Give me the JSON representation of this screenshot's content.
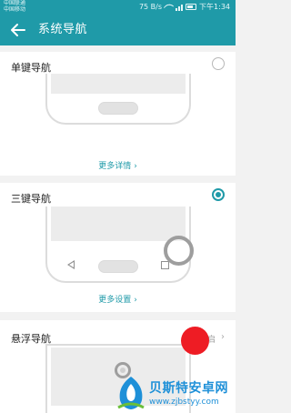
{
  "statusbar": {
    "carrier_line1": "中国联通",
    "carrier_line2": "中国移动",
    "speed": "75 B/s",
    "time": "下午1:34"
  },
  "header": {
    "title": "系统导航",
    "back_icon": "arrow-left-icon",
    "background_color": "#1f9aa8"
  },
  "options": [
    {
      "label": "单键导航",
      "selected": false,
      "link_label": "更多详情",
      "link_icon": "chevron-right-icon"
    },
    {
      "label": "三键导航",
      "selected": true,
      "link_label": "更多设置",
      "link_icon": "chevron-right-icon"
    },
    {
      "label": "悬浮导航",
      "status": "启",
      "chevron_icon": "chevron-right-icon"
    }
  ],
  "accent_color": "#1f9aa8",
  "watermark": {
    "title": "贝斯特安卓网",
    "url": "www.zjbstyy.com"
  }
}
